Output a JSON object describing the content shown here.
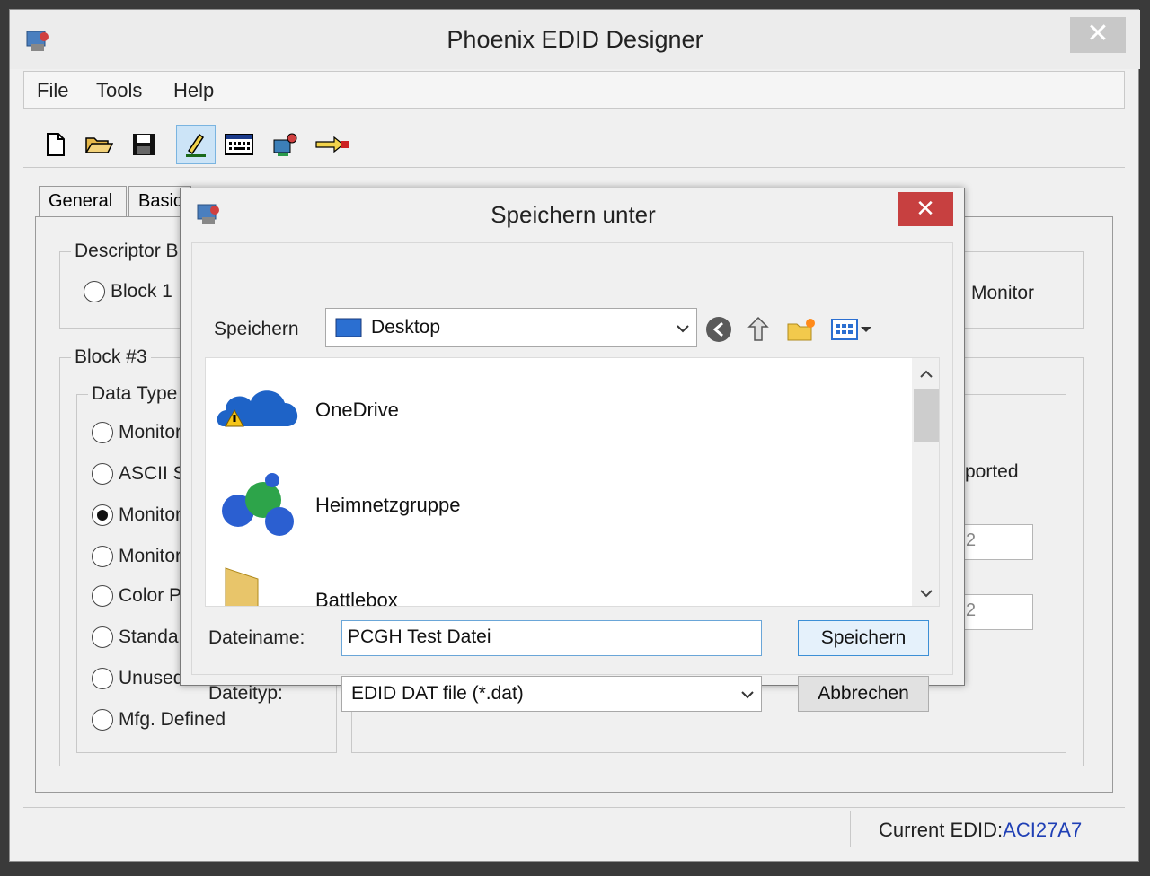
{
  "app": {
    "title": "Phoenix EDID Designer",
    "close_glyph": "✕"
  },
  "menu": [
    "File",
    "Tools",
    "Help"
  ],
  "toolbar": [
    "new-file-icon",
    "open-folder-icon",
    "save-icon",
    "edit-pencil-icon",
    "keyboard-icon",
    "machine-icon",
    "arrow-export-icon"
  ],
  "tabs": [
    "General",
    "Basic"
  ],
  "descriptor": {
    "legend": "Descriptor B",
    "radio_label": "Block 1",
    "right_text": "Monitor"
  },
  "block": {
    "legend": "Block #3",
    "data_type_legend": "Data Type",
    "options": [
      "Monitor",
      "ASCII S",
      "Monitor",
      "Monitor",
      "Color P",
      "Standa",
      "Unused",
      "Mfg. Defined"
    ],
    "selected_index": 2,
    "right_label": "ported",
    "field1": "2",
    "field2": "2"
  },
  "status": {
    "label": "Current EDID:",
    "value": "ACI27A7"
  },
  "dialog": {
    "title": "Speichern unter",
    "close_glyph": "✕",
    "location_label": "Speichern",
    "location_value": "Desktop",
    "nav_icons": [
      "back-arrow-icon",
      "up-folder-icon",
      "new-folder-icon",
      "view-menu-icon"
    ],
    "items": [
      {
        "name": "OneDrive",
        "icon": "onedrive-cloud-icon"
      },
      {
        "name": "Heimnetzgruppe",
        "icon": "homegroup-icon"
      },
      {
        "name": "Battlebox",
        "icon": "user-folder-icon"
      }
    ],
    "filename_label": "Dateiname:",
    "filename_value": "PCGH Test Datei",
    "filetype_label": "Dateityp:",
    "filetype_value": "EDID DAT file (*.dat)",
    "save_button": "Speichern",
    "cancel_button": "Abbrechen"
  },
  "colors": {
    "accent": "#1f3fb5",
    "close_red": "#c74040"
  }
}
